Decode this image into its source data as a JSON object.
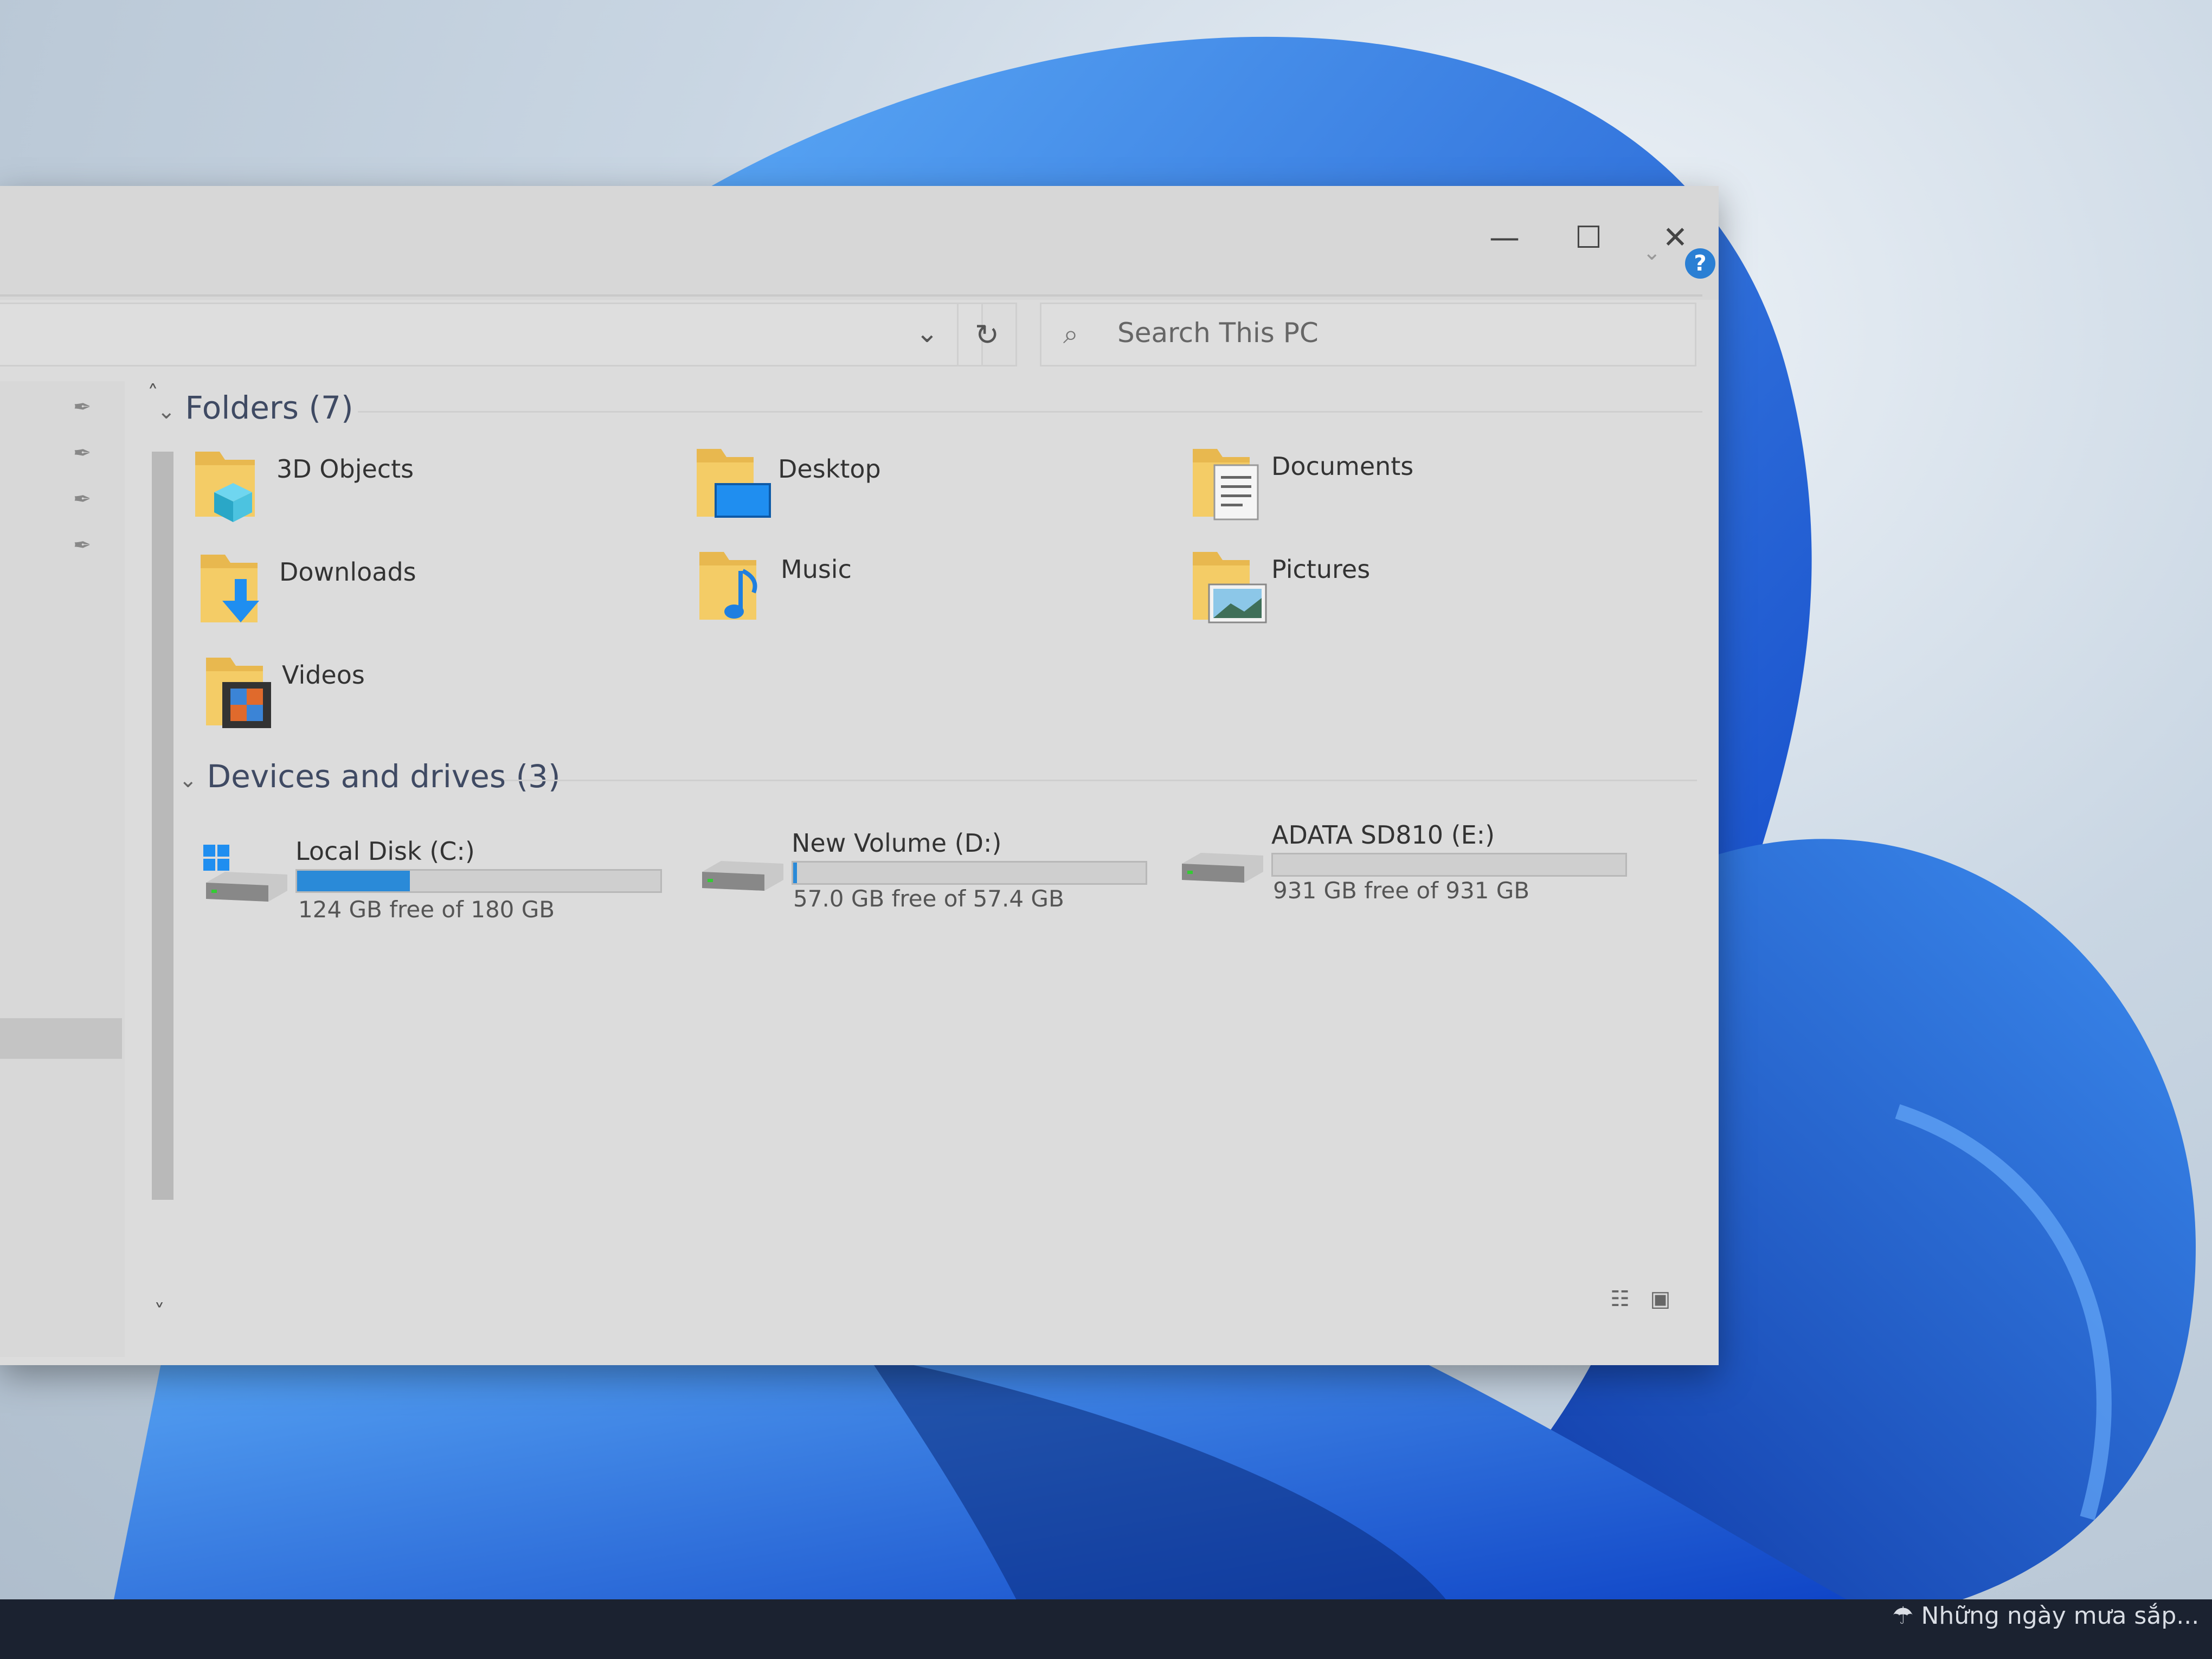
{
  "window": {
    "controls": {
      "minimize": "—",
      "maximize": "☐",
      "close": "✕"
    },
    "help": "?"
  },
  "search": {
    "placeholder": "Search This PC"
  },
  "folders_group": {
    "title": "Folders (7)",
    "items": [
      {
        "label": "3D Objects",
        "icon": "3d-objects-folder-icon"
      },
      {
        "label": "Desktop",
        "icon": "desktop-folder-icon"
      },
      {
        "label": "Documents",
        "icon": "documents-folder-icon"
      },
      {
        "label": "Downloads",
        "icon": "downloads-folder-icon"
      },
      {
        "label": "Music",
        "icon": "music-folder-icon"
      },
      {
        "label": "Pictures",
        "icon": "pictures-folder-icon"
      },
      {
        "label": "Videos",
        "icon": "videos-folder-icon"
      }
    ]
  },
  "drives_group": {
    "title": "Devices and drives (3)",
    "items": [
      {
        "label": "Local Disk (C:)",
        "free_text": "124 GB free of 180 GB",
        "used_fraction": 0.31,
        "icon": "windows-drive-icon"
      },
      {
        "label": "New Volume (D:)",
        "free_text": "57.0 GB free of 57.4 GB",
        "used_fraction": 0.01,
        "icon": "drive-icon"
      },
      {
        "label": "ADATA SD810 (E:)",
        "free_text": "931 GB free of 931 GB",
        "used_fraction": 0.0,
        "icon": "drive-icon"
      }
    ]
  },
  "taskbar": {
    "weather_text": "Những ngày mưa sắp..."
  },
  "colors": {
    "accent": "#2a8ad8",
    "wallpaper_blue": "#1f5fe0"
  }
}
